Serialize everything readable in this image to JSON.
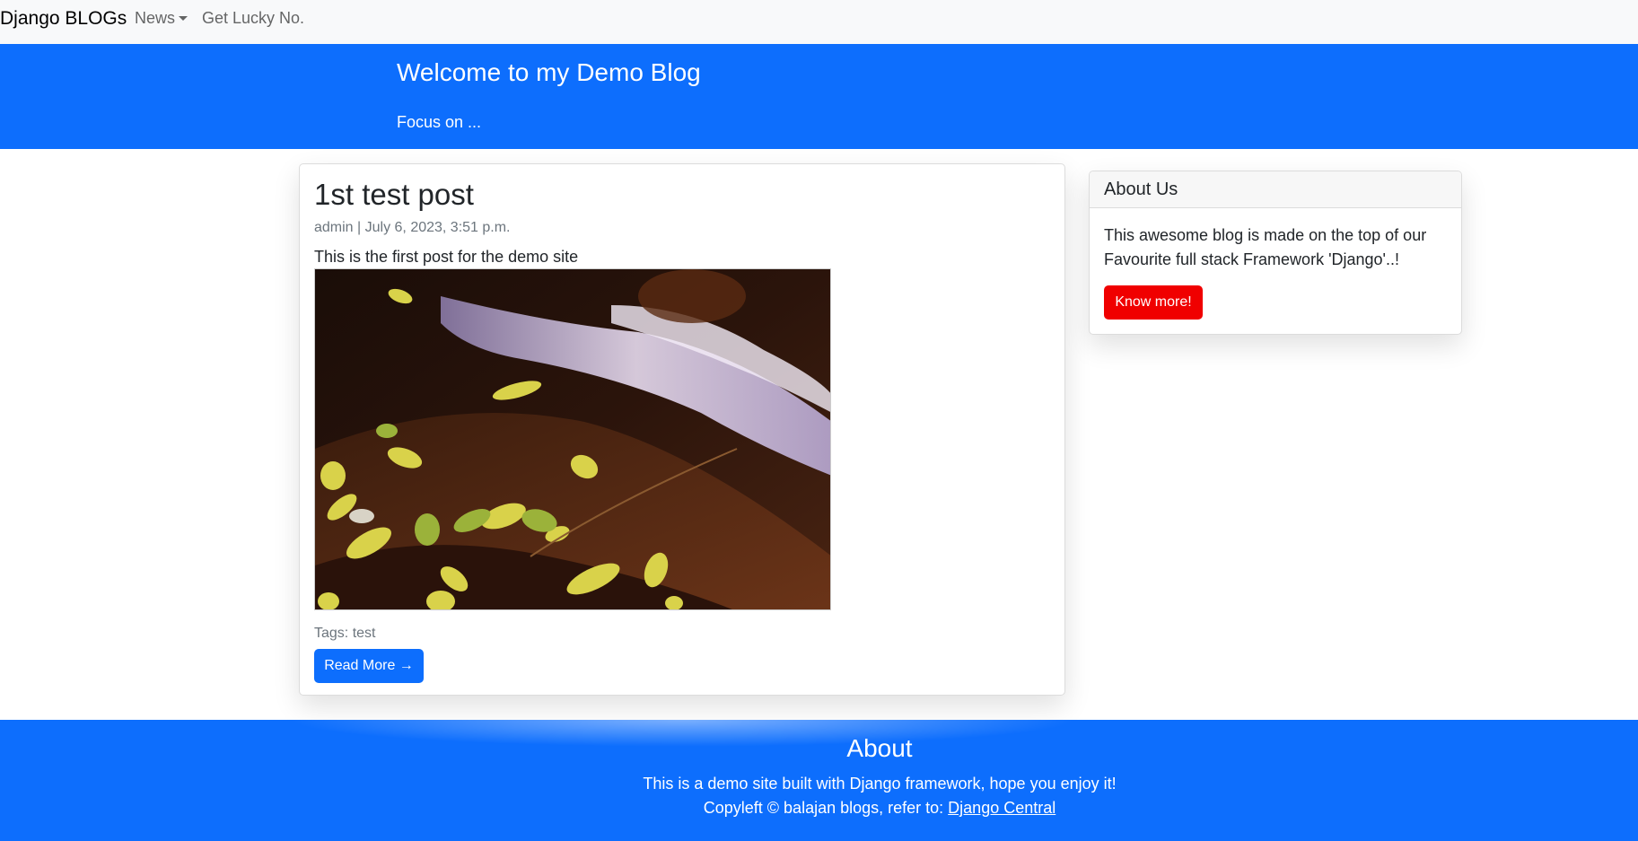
{
  "navbar": {
    "brand": "Django BLOGs",
    "items": [
      {
        "label": "News",
        "dropdown": true
      },
      {
        "label": "Get Lucky No."
      }
    ]
  },
  "masthead": {
    "title": "Welcome to my Demo Blog",
    "subtitle": "Focus on ..."
  },
  "post": {
    "title": "1st test post",
    "meta": "admin | July 6, 2023, 3:51 p.m.",
    "body": "This is the first post for the demo site",
    "image_alt": "waterfall with yellow leaves on rocks",
    "tags": "Tags: test",
    "read_more": "Read More →"
  },
  "sidebar": {
    "heading": "About Us",
    "text": "This awesome blog is made on the top of our Favourite full stack Framework 'Django'..!",
    "button": "Know more!"
  },
  "footer": {
    "title": "About",
    "line1": "This is a demo site built with Django framework, hope you enjoy it!",
    "line2_prefix": "Copyleft © balajan blogs, refer to: ",
    "link": "Django Central"
  },
  "colors": {
    "primary": "#0d6efd",
    "danger": "#f00000",
    "navbar_bg": "#f8f9fa"
  }
}
